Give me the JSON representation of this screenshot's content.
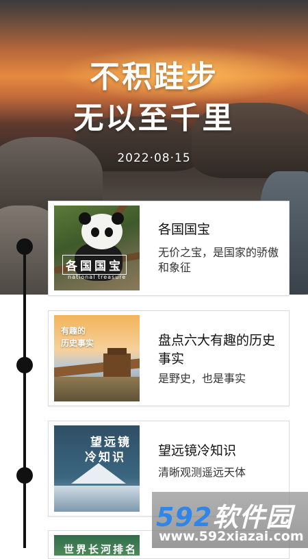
{
  "hero": {
    "title_line1": "不积跬步",
    "title_line2": "无以至千里",
    "date": "2022·08·15"
  },
  "cards": [
    {
      "title": "各国国宝",
      "desc": "无价之宝，是国家的骄傲和象征",
      "thumb_label": "各国国宝",
      "thumb_sub": "national treasure"
    },
    {
      "title": "盘点六大有趣的历史事实",
      "desc": "是野史，也是事实",
      "thumb_label_line1": "有趣的",
      "thumb_label_line2": "历史事实"
    },
    {
      "title": "望远镜冷知识",
      "desc": "清晰观测遥远天体",
      "thumb_label_line1": "望远镜",
      "thumb_label_line2": "冷知识"
    },
    {
      "thumb_label": "世界长河排名"
    }
  ],
  "watermark": {
    "brand_num": "592",
    "brand_text": "软件园",
    "url": "www.592xiazai.com"
  },
  "colors": {
    "timeline": "#111111",
    "watermark_blue": "#2f86e8"
  }
}
